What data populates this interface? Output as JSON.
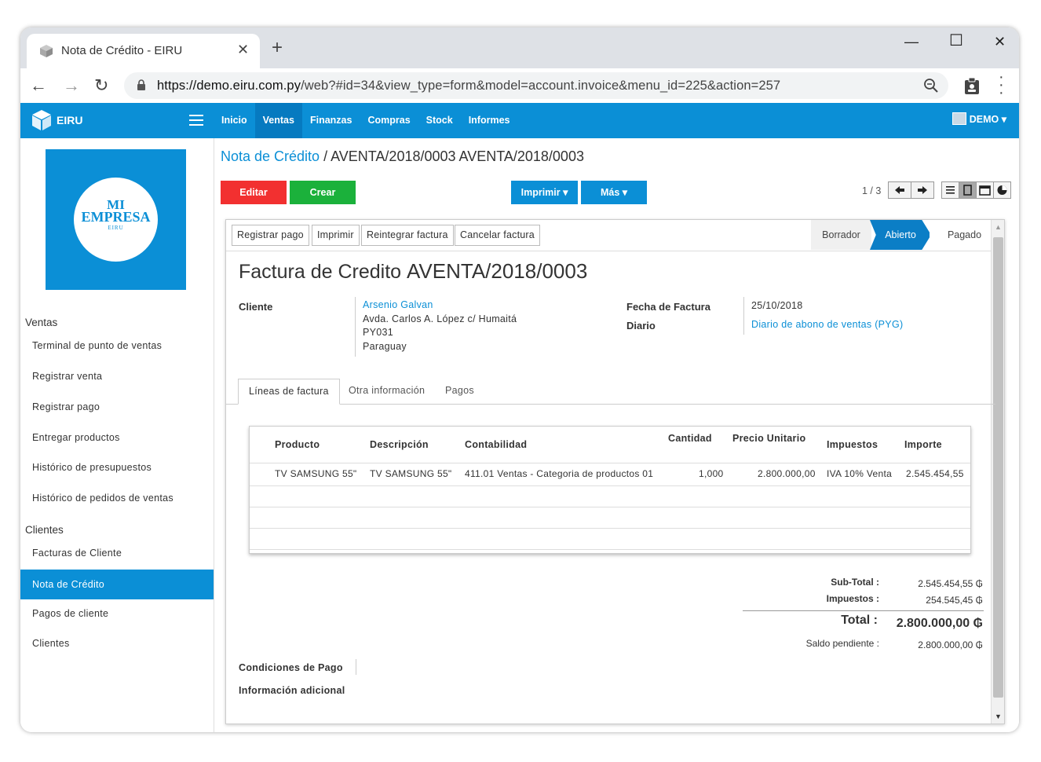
{
  "browser": {
    "tab_title": "Nota de Crédito - EIRU",
    "tab_close": "✕",
    "new_tab": "+",
    "url_host": "https://demo.eiru.com.py",
    "url_path": "/web?#id=34&view_type=form&model=account.invoice&menu_id=225&action=257",
    "controls": {
      "minimize": "—",
      "maximize": "☐",
      "close": "✕"
    }
  },
  "navbar": {
    "brand": "EIRU",
    "menu": [
      "Inicio",
      "Ventas",
      "Finanzas",
      "Compras",
      "Stock",
      "Informes"
    ],
    "active_menu": "Ventas",
    "user": "DEMO ▾"
  },
  "sidebar": {
    "logo": {
      "line1": "MI",
      "line2": "EMPRESA",
      "line3": "EIRU"
    },
    "sections": [
      {
        "title": "Ventas",
        "items": [
          "Terminal de punto de ventas",
          "Registrar venta",
          "Registrar pago",
          "Entregar productos",
          "Histórico de presupuestos",
          "Histórico de pedidos de ventas"
        ]
      },
      {
        "title": "Clientes",
        "items": [
          "Facturas de Cliente",
          "Nota de Crédito",
          "Pagos de cliente",
          "Clientes"
        ]
      }
    ],
    "active_item": "Nota de Crédito"
  },
  "header": {
    "breadcrumb_link": "Nota de Crédito",
    "breadcrumb_rest": " / AVENTA/2018/0003 AVENTA/2018/0003",
    "buttons": {
      "edit": "Editar",
      "create": "Crear",
      "print": "Imprimir ▾",
      "more": "Más ▾"
    },
    "pager": "1 / 3"
  },
  "form": {
    "actions": [
      "Registrar pago",
      "Imprimir",
      "Reintegrar factura",
      "Cancelar factura"
    ],
    "stages": [
      "Borrador",
      "Abierto",
      "Pagado"
    ],
    "active_stage": "Abierto",
    "title": "Factura de Credito",
    "number": "AVENTA/2018/0003",
    "customer_label": "Cliente",
    "customer_name": "Arsenio Galvan",
    "customer_address": [
      "Avda. Carlos A. López c/ Humaitá",
      "PY031",
      "Paraguay"
    ],
    "date_label": "Fecha de Factura",
    "date_value": "25/10/2018",
    "journal_label": "Diario",
    "journal_value": "Diario de abono de ventas (PYG)",
    "tabs": [
      "Líneas de factura",
      "Otra información",
      "Pagos"
    ],
    "active_tab": "Líneas de factura",
    "columns": [
      "Producto",
      "Descripción",
      "Contabilidad",
      "Cantidad",
      "Precio Unitario",
      "Impuestos",
      "Importe"
    ],
    "lines": [
      {
        "product": "TV SAMSUNG 55\"",
        "description": "TV SAMSUNG 55\"",
        "account": "411.01 Ventas - Categoria de productos 01",
        "quantity": "1,000",
        "unit_price": "2.800.000,00",
        "taxes": "IVA 10% Venta",
        "amount": "2.545.454,55"
      }
    ],
    "totals": {
      "subtotal_label": "Sub-Total :",
      "subtotal_value": "2.545.454,55 ₲",
      "tax_label": "Impuestos :",
      "tax_value": "254.545,45 ₲",
      "total_label": "Total :",
      "total_value": "2.800.000,00 ₲",
      "due_label": "Saldo pendiente :",
      "due_value": "2.800.000,00 ₲"
    },
    "payment_terms_label": "Condiciones de Pago",
    "additional_info_label": "Información adicional"
  }
}
